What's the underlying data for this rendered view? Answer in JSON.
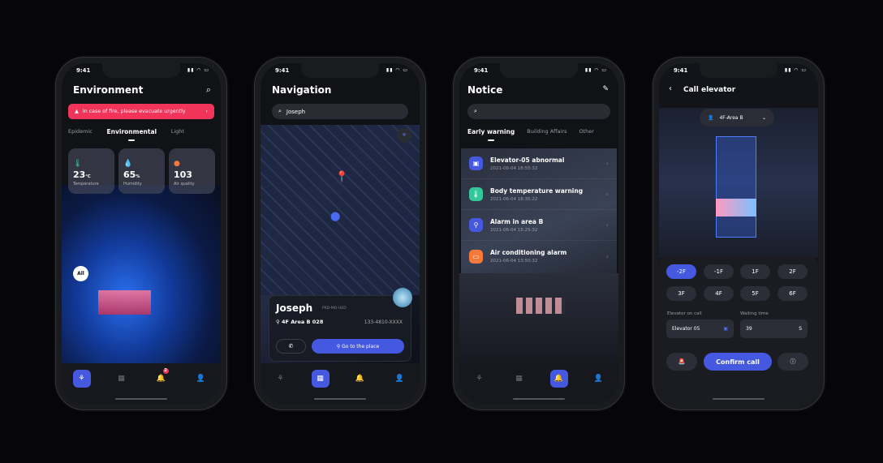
{
  "status_time": "9:41",
  "colors": {
    "accent": "#4458e0",
    "alert": "#f0345a",
    "green": "#33c79a",
    "orange": "#f57a3a"
  },
  "environment": {
    "title": "Environment",
    "alert": "In case of fire, please evacuate urgently",
    "tabs": [
      "Epidemic",
      "Environmental",
      "Light"
    ],
    "cards": [
      {
        "icon": "thermometer-icon",
        "value": "23",
        "unit": "°C",
        "label": "Temperature"
      },
      {
        "icon": "droplet-icon",
        "value": "65",
        "unit": "%",
        "label": "Humidity"
      },
      {
        "icon": "air-quality-icon",
        "value": "103",
        "unit": "",
        "label": "Air quality"
      }
    ],
    "all_label": "All",
    "nav_badge": "2"
  },
  "navigation": {
    "title": "Navigation",
    "search_value": "Joseph",
    "person": {
      "name": "Joseph",
      "code": "PRD-MO-UED",
      "location": "4F Area B  028",
      "phone": "133-4810-XXXX"
    },
    "go_label": "Go to the place"
  },
  "notice": {
    "title": "Notice",
    "tabs": [
      "Early warning",
      "Building Affairs",
      "Other"
    ],
    "items": [
      {
        "icon": "elevator-icon",
        "title": "Elevator-05 abnormal",
        "time": "2021-06-04  16:55:32",
        "color": "#4458e0"
      },
      {
        "icon": "thermometer-icon",
        "title": "Body temperature warning",
        "time": "2021-06-04  16:35:22",
        "color": "#33c79a"
      },
      {
        "icon": "location-pin-icon",
        "title": "Alarm in area B",
        "time": "2021-06-04  15:25:32",
        "color": "#4458e0"
      },
      {
        "icon": "air-conditioner-icon",
        "title": "Air conditioning alarm",
        "time": "2021-06-04  13:50:32",
        "color": "#f57a3a"
      }
    ]
  },
  "elevator": {
    "title": "Call elevator",
    "area": "4F-Area B",
    "floors": [
      "-2F",
      "-1F",
      "1F",
      "2F",
      "3F",
      "4F",
      "5F",
      "6F"
    ],
    "selected_floor": "-2F",
    "elevator_label": "Elevator on call",
    "elevator_value": "Elevator 05",
    "waiting_label": "Waiting time",
    "waiting_value": "39",
    "waiting_unit": "S",
    "confirm_label": "Confirm call"
  }
}
